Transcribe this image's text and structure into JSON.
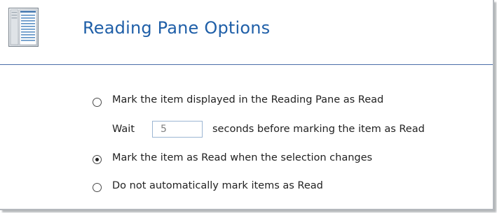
{
  "header": {
    "title": "Reading Pane Options",
    "icon": "reading-pane-icon"
  },
  "options": [
    {
      "label": "Mark the item displayed in the Reading Pane as Read",
      "selected": false
    },
    {
      "label": "Mark the item as Read when the selection changes",
      "selected": true
    },
    {
      "label": "Do not automatically mark items as Read",
      "selected": false
    }
  ],
  "wait": {
    "prefix": "Wait",
    "value": "5",
    "suffix": "seconds before marking the item as Read"
  },
  "colors": {
    "title": "#1f5fa8",
    "header_rule": "#4a6ea9",
    "input_border": "#9cb6d3"
  }
}
